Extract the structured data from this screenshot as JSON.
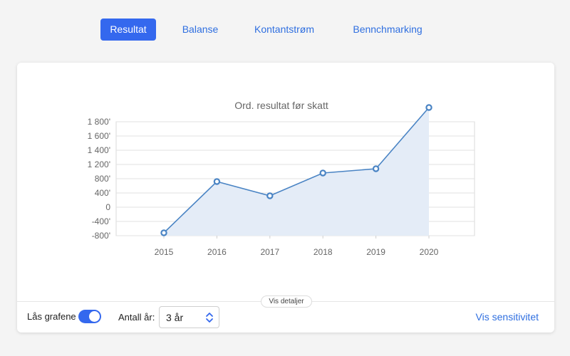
{
  "tabs": [
    {
      "label": "Resultat",
      "active": true
    },
    {
      "label": "Balanse",
      "active": false
    },
    {
      "label": "Kontantstrøm",
      "active": false
    },
    {
      "label": "Bennchmarking",
      "active": false
    }
  ],
  "chart_data": {
    "type": "area",
    "title": "Ord. resultat før skatt",
    "x": [
      "2015",
      "2016",
      "2017",
      "2018",
      "2019",
      "2020"
    ],
    "series": [
      {
        "values": [
          -720,
          720,
          320,
          960,
          1080,
          2000
        ]
      }
    ],
    "yticks": [
      "1 800'",
      "1 600'",
      "1 400'",
      "1 200'",
      "800'",
      "400'",
      "0",
      "-400'",
      "-800'"
    ],
    "xlabel": "",
    "ylabel": "",
    "grid": true,
    "colors": {
      "line": "#4a84c4",
      "fill": "#e4ecf7"
    }
  },
  "details_button": "Vis detaljer",
  "footer": {
    "lock_label": "Lås grafene",
    "lock_on": true,
    "years_label": "Antall år:",
    "years_value": "3 år",
    "sensitivity_link": "Vis sensitivitet"
  },
  "colors": {
    "accent": "#3468ee",
    "link": "#2f6fe0"
  }
}
